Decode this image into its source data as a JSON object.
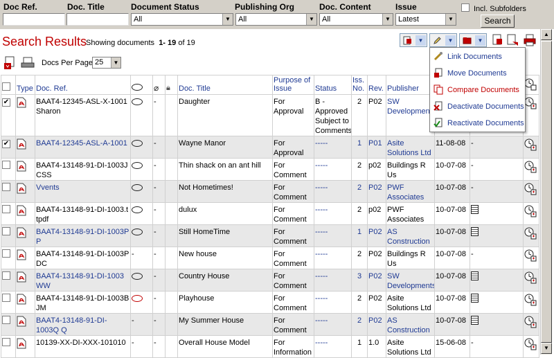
{
  "filters": {
    "doc_ref_label": "Doc Ref.",
    "doc_title_label": "Doc. Title",
    "doc_status_label": "Document Status",
    "doc_status_value": "All",
    "publishing_org_label": "Publishing Org",
    "publishing_org_value": "All",
    "doc_content_label": "Doc. Content",
    "doc_content_value": "All",
    "issue_label": "Issue",
    "issue_value": "Latest",
    "incl_subfolders_label": "Incl. Subfolders",
    "search_button": "Search"
  },
  "header": {
    "title": "Search Results",
    "showing_prefix": "Showing documents",
    "range": "1- 19",
    "of_text": "of 19",
    "docs_per_page_label": "Docs Per Page",
    "docs_per_page_value": "25"
  },
  "columns": [
    "Type",
    "Doc. Ref.",
    "Doc. Title",
    "Purpose of Issue",
    "Status",
    "Iss. No.",
    "Rev.",
    "Publisher"
  ],
  "menu": {
    "items": [
      {
        "label": "Link Documents"
      },
      {
        "label": "Move Documents"
      },
      {
        "label": "Compare Documents"
      },
      {
        "label": "Deactivate Documents"
      },
      {
        "label": "Reactivate Documents"
      }
    ]
  },
  "rows": [
    {
      "checked": true,
      "ref": "BAAT4-12345-ASL-X-1001 Sharon",
      "comment": "bubble",
      "attach": "-",
      "title": "Daughter",
      "purpose": "For Approval",
      "status": "B - Approved Subject to Comments",
      "status_link": false,
      "iss": "2",
      "iss_link": false,
      "rev": "P02",
      "rev_link": false,
      "publisher": "SW Developments",
      "pub_link": true,
      "date": "",
      "doc": "",
      "ref_link": false
    },
    {
      "checked": true,
      "ref": "BAAT4-12345-ASL-A-1001",
      "comment": "bubble",
      "attach": "-",
      "title": "Wayne Manor",
      "purpose": "For Approval",
      "status": "-----",
      "status_link": true,
      "iss": "1",
      "iss_link": true,
      "rev": "P01",
      "rev_link": true,
      "publisher": "Asite Solutions Ltd",
      "pub_link": true,
      "date": "11-08-08",
      "doc": "-",
      "ref_link": true
    },
    {
      "checked": false,
      "ref": "BAAT4-13148-91-DI-1003J CSS",
      "comment": "bubble",
      "attach": "-",
      "title": "Thin shack on an ant hill",
      "purpose": "For Comment",
      "status": "-----",
      "status_link": true,
      "iss": "2",
      "iss_link": false,
      "rev": "p02",
      "rev_link": false,
      "publisher": "Buildings R Us",
      "pub_link": false,
      "date": "10-07-08",
      "doc": "-",
      "ref_link": false
    },
    {
      "checked": false,
      "ref": "Vvents",
      "comment": "bubble",
      "attach": "-",
      "title": "Not Hometimes!",
      "purpose": "For Comment",
      "status": "-----",
      "status_link": true,
      "iss": "2",
      "iss_link": true,
      "rev": "P02",
      "rev_link": true,
      "publisher": "PWF Associates",
      "pub_link": true,
      "date": "10-07-08",
      "doc": "-",
      "ref_link": true
    },
    {
      "checked": false,
      "ref": "BAAT4-13148-91-DI-1003.t tpdf",
      "comment": "bubble",
      "attach": "-",
      "title": "dulux",
      "purpose": "For Comment",
      "status": "-----",
      "status_link": true,
      "iss": "2",
      "iss_link": false,
      "rev": "p02",
      "rev_link": false,
      "publisher": "PWF Associates",
      "pub_link": false,
      "date": "10-07-08",
      "doc": "icon",
      "ref_link": false
    },
    {
      "checked": false,
      "ref": "BAAT4-13148-91-DI-1003P P",
      "comment": "bubble",
      "attach": "-",
      "title": "Still HomeTime",
      "purpose": "For Comment",
      "status": "-----",
      "status_link": true,
      "iss": "1",
      "iss_link": true,
      "rev": "P02",
      "rev_link": true,
      "publisher": "AS Construction",
      "pub_link": true,
      "date": "10-07-08",
      "doc": "icon",
      "ref_link": true
    },
    {
      "checked": false,
      "ref": "BAAT4-13148-91-DI-1003P DC",
      "comment": "-",
      "attach": "-",
      "title": "New house",
      "purpose": "For Comment",
      "status": "-----",
      "status_link": true,
      "iss": "2",
      "iss_link": false,
      "rev": "P02",
      "rev_link": false,
      "publisher": "Buildings R Us",
      "pub_link": false,
      "date": "10-07-08",
      "doc": "-",
      "ref_link": false
    },
    {
      "checked": false,
      "ref": "BAAT4-13148-91-DI-1003 WW",
      "comment": "bubble",
      "attach": "-",
      "title": "Country House",
      "purpose": "For Comment",
      "status": "-----",
      "status_link": true,
      "iss": "3",
      "iss_link": true,
      "rev": "P02",
      "rev_link": true,
      "publisher": "SW Developments",
      "pub_link": true,
      "date": "10-07-08",
      "doc": "icon",
      "ref_link": true
    },
    {
      "checked": false,
      "ref": "BAAT4-13148-91-DI-1003B JM",
      "comment": "red",
      "attach": "-",
      "title": "Playhouse",
      "purpose": "For Comment",
      "status": "-----",
      "status_link": true,
      "iss": "2",
      "iss_link": false,
      "rev": "P02",
      "rev_link": false,
      "publisher": "Asite Solutions Ltd",
      "pub_link": false,
      "date": "10-07-08",
      "doc": "icon",
      "ref_link": false
    },
    {
      "checked": false,
      "ref": "BAAT4-13148-91-DI-1003Q Q",
      "comment": "-",
      "attach": "-",
      "title": "My Summer House",
      "purpose": "For Comment",
      "status": "-----",
      "status_link": true,
      "iss": "2",
      "iss_link": true,
      "rev": "P02",
      "rev_link": true,
      "publisher": "AS Construction",
      "pub_link": true,
      "date": "10-07-08",
      "doc": "icon",
      "ref_link": true
    },
    {
      "checked": false,
      "ref": "10139-XX-DI-XXX-101010",
      "comment": "-",
      "attach": "-",
      "title": "Overall House Model",
      "purpose": "For Information",
      "status": "-----",
      "status_link": true,
      "iss": "1",
      "iss_link": false,
      "rev": "1.0",
      "rev_link": false,
      "publisher": "Asite Solutions Ltd",
      "pub_link": false,
      "date": "15-06-08",
      "doc": "-",
      "ref_link": false
    }
  ]
}
